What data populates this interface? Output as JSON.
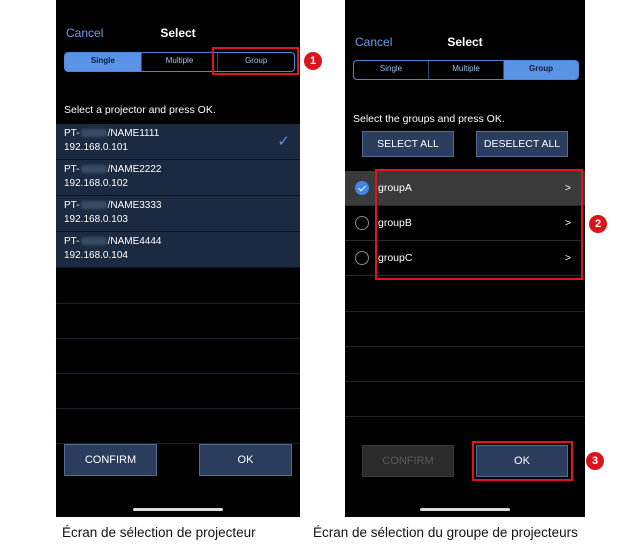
{
  "screen1": {
    "cancel": "Cancel",
    "title": "Select",
    "tabs": [
      "Single",
      "Multiple",
      "Group"
    ],
    "active_tab": "Single",
    "instruction": "Select a projector and press OK.",
    "projectors": [
      {
        "prefix": "PT-",
        "name": "/NAME1111",
        "ip": "192.168.0.101",
        "checked": true
      },
      {
        "prefix": "PT-",
        "name": "/NAME2222",
        "ip": "192.168.0.102",
        "checked": false
      },
      {
        "prefix": "PT-",
        "name": "/NAME3333",
        "ip": "192.168.0.103",
        "checked": false
      },
      {
        "prefix": "PT-",
        "name": "/NAME4444",
        "ip": "192.168.0.104",
        "checked": false
      }
    ],
    "check_icon": "✓",
    "confirm": "CONFIRM",
    "ok": "OK",
    "caption": "Écran de sélection de projecteur"
  },
  "screen2": {
    "cancel": "Cancel",
    "title": "Select",
    "tabs": [
      "Single",
      "Multiple",
      "Group"
    ],
    "active_tab": "Group",
    "instruction": "Select the groups and press OK.",
    "select_all": "SELECT ALL",
    "deselect_all": "DESELECT ALL",
    "groups": [
      {
        "name": "groupA",
        "selected": true,
        "chevron": ">"
      },
      {
        "name": "groupB",
        "selected": false,
        "chevron": ">"
      },
      {
        "name": "groupC",
        "selected": false,
        "chevron": ">"
      }
    ],
    "confirm": "CONFIRM",
    "confirm_disabled": true,
    "ok": "OK",
    "caption": "Écran de sélection du groupe de projecteurs"
  },
  "callouts": [
    "1",
    "2",
    "3"
  ],
  "colors": {
    "accent": "#5a93e6",
    "highlight": "#e0141e",
    "button_bg": "#2a3d5c"
  }
}
